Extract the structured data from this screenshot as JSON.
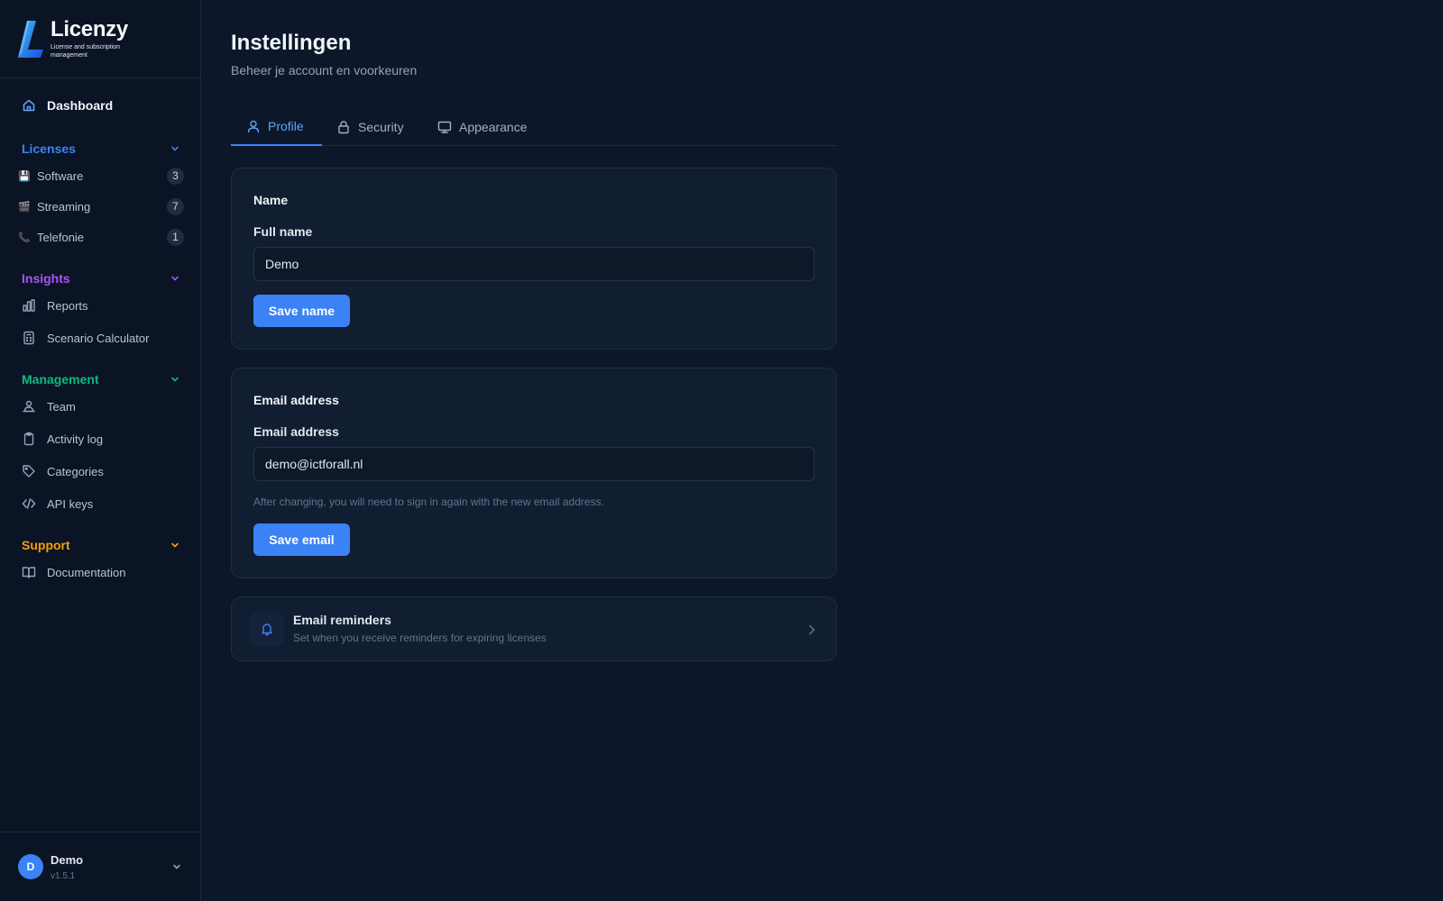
{
  "brand": {
    "name": "Licenzy",
    "tagline": "License and subscription management"
  },
  "sidebar": {
    "dashboard": {
      "label": "Dashboard",
      "icon": "home-icon"
    },
    "sections": [
      {
        "title": "Licenses",
        "color": "#3b82f6",
        "items": [
          {
            "label": "Software",
            "emoji": "💾",
            "count": "3"
          },
          {
            "label": "Streaming",
            "emoji": "🎬",
            "count": "7"
          },
          {
            "label": "Telefonie",
            "emoji": "📞",
            "count": "1"
          }
        ]
      },
      {
        "title": "Insights",
        "color": "#a855f7",
        "items": [
          {
            "label": "Reports",
            "icon": "bar-chart-icon"
          },
          {
            "label": "Scenario Calculator",
            "icon": "calculator-icon"
          }
        ]
      },
      {
        "title": "Management",
        "color": "#10b981",
        "items": [
          {
            "label": "Team",
            "icon": "team-icon"
          },
          {
            "label": "Activity log",
            "icon": "clipboard-icon"
          },
          {
            "label": "Categories",
            "icon": "tag-icon"
          },
          {
            "label": "API keys",
            "icon": "code-icon"
          }
        ]
      },
      {
        "title": "Support",
        "color": "#f59e0b",
        "items": [
          {
            "label": "Documentation",
            "icon": "book-icon"
          }
        ]
      }
    ],
    "user": {
      "initial": "D",
      "name": "Demo",
      "version": "v1.5.1"
    }
  },
  "page": {
    "title": "Instellingen",
    "subtitle": "Beheer je account en voorkeuren"
  },
  "tabs": [
    {
      "label": "Profile",
      "icon": "user-icon",
      "active": true
    },
    {
      "label": "Security",
      "icon": "lock-icon",
      "active": false
    },
    {
      "label": "Appearance",
      "icon": "monitor-icon",
      "active": false
    }
  ],
  "name_card": {
    "title": "Name",
    "field_label": "Full name",
    "value": "Demo",
    "button": "Save name"
  },
  "email_card": {
    "title": "Email address",
    "field_label": "Email address",
    "value": "demo@ictforall.nl",
    "hint": "After changing, you will need to sign in again with the new email address.",
    "button": "Save email"
  },
  "reminders": {
    "title": "Email reminders",
    "subtitle": "Set when you receive reminders for expiring licenses",
    "icon": "bell-icon"
  },
  "colors": {
    "accent": "#3b82f6",
    "background": "#0c1829",
    "sidebar": "#0b1424",
    "card": "#111d31"
  }
}
